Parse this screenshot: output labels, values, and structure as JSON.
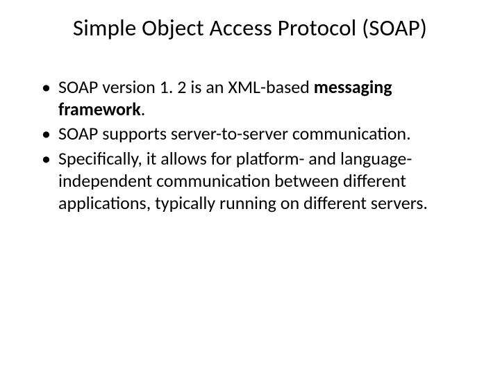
{
  "title": "Simple Object Access Protocol (SOAP)",
  "bullets": {
    "item0_prefix": "SOAP version 1. 2 is an XML-based ",
    "item0_bold": "messaging framework",
    "item0_suffix": ".",
    "item1": "SOAP supports server-to-server communication.",
    "item2": "Specifically, it allows for platform- and language-independent communication between different applications, typically running on different servers."
  }
}
